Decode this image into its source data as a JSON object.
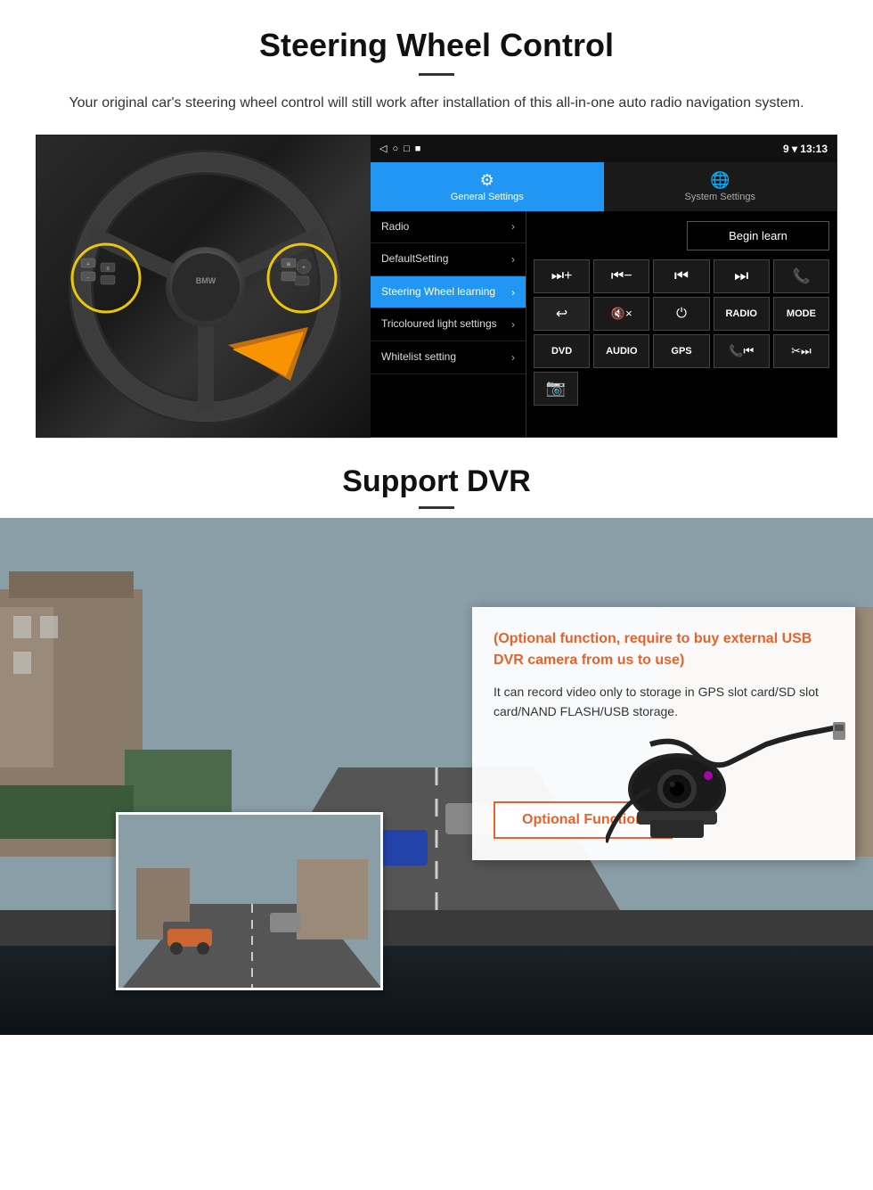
{
  "steering": {
    "title": "Steering Wheel Control",
    "subtitle": "Your original car's steering wheel control will still work after installation of this all-in-one auto radio navigation system.",
    "android": {
      "topbar": {
        "icons": [
          "◁",
          "○",
          "□",
          "■"
        ],
        "status": "9 ▾ 13:13"
      },
      "tabs": [
        {
          "label": "General Settings",
          "active": true
        },
        {
          "label": "System Settings",
          "active": false
        }
      ],
      "menu_items": [
        {
          "label": "Radio",
          "active": false
        },
        {
          "label": "DefaultSetting",
          "active": false
        },
        {
          "label": "Steering Wheel learning",
          "active": true
        },
        {
          "label": "Tricoloured light settings",
          "active": false
        },
        {
          "label": "Whitelist setting",
          "active": false
        }
      ],
      "begin_learn": "Begin learn",
      "control_buttons": [
        [
          "⏮+",
          "⏮−",
          "⏮⏮",
          "⏭⏭",
          "📞"
        ],
        [
          "↩",
          "🔇×",
          "⏻",
          "RADIO",
          "MODE"
        ],
        [
          "DVD",
          "AUDIO",
          "GPS",
          "📞⏮",
          "✂⏭"
        ],
        [
          "📷"
        ]
      ]
    }
  },
  "dvr": {
    "title": "Support DVR",
    "optional_text": "(Optional function, require to buy external USB DVR camera from us to use)",
    "description": "It can record video only to storage in GPS slot card/SD slot card/NAND FLASH/USB storage.",
    "optional_btn": "Optional Function"
  }
}
